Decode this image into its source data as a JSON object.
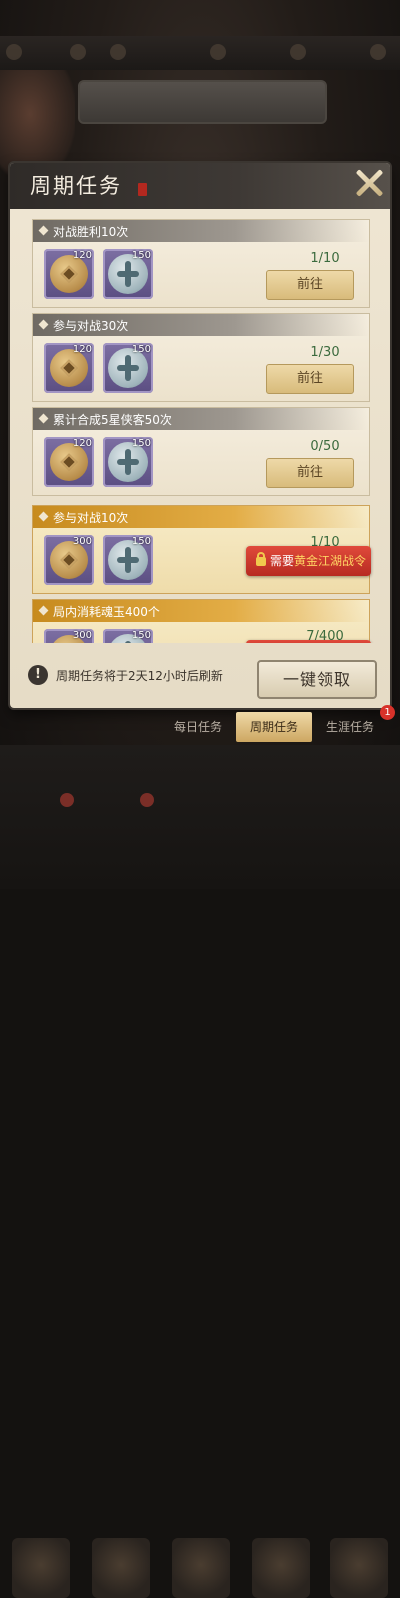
{
  "dialog": {
    "title": "周期任务",
    "footer_info": "周期任务将于2天12小时后刷新",
    "claim_all_label": "一键领取"
  },
  "tasks": [
    {
      "name": "对战胜利10次",
      "rewards": [
        {
          "icon": "coin-icon",
          "qty": "120"
        },
        {
          "icon": "jade-icon",
          "qty": "150"
        }
      ],
      "progress": "1/10",
      "button": "前往",
      "locked": false
    },
    {
      "name": "参与对战30次",
      "rewards": [
        {
          "icon": "coin-icon",
          "qty": "120"
        },
        {
          "icon": "jade-icon",
          "qty": "150"
        }
      ],
      "progress": "1/30",
      "button": "前往",
      "locked": false
    },
    {
      "name": "累计合成5星侠客50次",
      "rewards": [
        {
          "icon": "coin-icon",
          "qty": "120"
        },
        {
          "icon": "jade-icon",
          "qty": "150"
        }
      ],
      "progress": "0/50",
      "button": "前往",
      "locked": false
    },
    {
      "name": "参与对战10次",
      "rewards": [
        {
          "icon": "coin-icon",
          "qty": "300"
        },
        {
          "icon": "jade-icon",
          "qty": "150"
        }
      ],
      "progress": "1/10",
      "button": "",
      "locked": true,
      "lock_prefix": "需要",
      "lock_highlight": "黄金江湖战令"
    },
    {
      "name": "局内消耗魂玉400个",
      "rewards": [
        {
          "icon": "coin-icon",
          "qty": "300"
        },
        {
          "icon": "jade-icon",
          "qty": "150"
        }
      ],
      "progress": "7/400",
      "button": "",
      "locked": true
    }
  ],
  "tabs": [
    {
      "label": "每日任务",
      "active": false
    },
    {
      "label": "周期任务",
      "active": true
    },
    {
      "label": "生涯任务",
      "active": false
    }
  ],
  "tab_badge": "1",
  "colors": {
    "accent_gold": "#cda762",
    "lock_red": "#c8352a",
    "panel_bg": "#efe6d3"
  }
}
